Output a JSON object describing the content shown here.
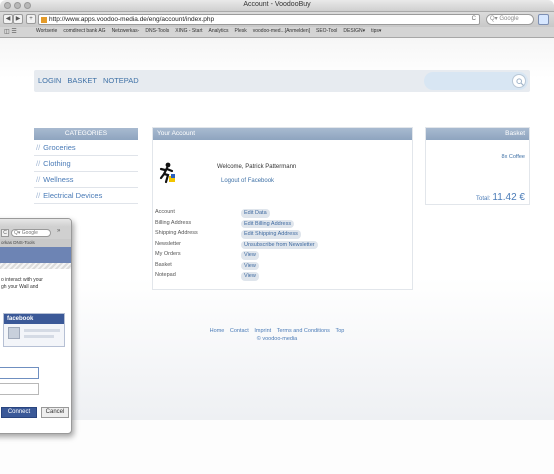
{
  "browser": {
    "window_title": "Account - VoodooBuy",
    "url": "http://www.apps.voodoo-media.de/eng/account/index.php",
    "search_placeholder": "Q▾ Google",
    "bookmarks": [
      "Wortserie",
      "comdirect bank AG",
      "Netzwerkas-",
      "DNS-Tools",
      "XING - Start",
      "Analytics",
      "Plesk",
      "voodoo-med...[Anmelden]",
      "SEO-Tool",
      "DESIGN▾",
      "tips▾"
    ]
  },
  "topnav": {
    "links": [
      "LOGIN",
      "BASKET",
      "NOTEPAD"
    ]
  },
  "categories": {
    "title": "CATEGORIES",
    "items": [
      "Groceries",
      "Clothing",
      "Wellness",
      "Electrical Devices"
    ]
  },
  "account": {
    "title": "Your Account",
    "welcome": "Welcome, Patrick Pattermann",
    "logout": "Logout of Facebook",
    "rows": [
      {
        "label": "Account",
        "button": "Edit Data"
      },
      {
        "label": "Billing Address",
        "button": "Edit Billing Address"
      },
      {
        "label": "Shipping Address",
        "button": "Edit Shipping Address"
      },
      {
        "label": "Newsletter",
        "button": "Unsubscribe from Newsletter"
      },
      {
        "label": "My Orders",
        "button": "View"
      },
      {
        "label": "Basket",
        "button": "View"
      },
      {
        "label": "Notepad",
        "button": "View"
      }
    ]
  },
  "basket": {
    "title": "Basket",
    "item": "8x Coffee",
    "total_label": "Total:",
    "total_value": "11.42 €"
  },
  "footer": {
    "links": [
      "Home",
      "Contact",
      "Imprint",
      "Terms and Conditions",
      "Top"
    ],
    "copyright": "© voodoo-media"
  },
  "popup": {
    "search_placeholder": "Q▾ Google",
    "bookmarks": "orkas   DNS-Tools",
    "text": "o interact with your\ngh your Wall and",
    "facebook_label": "facebook",
    "connect_label": "Connect",
    "cancel_label": "Cancel"
  },
  "colors": {
    "accent": "#4a7bb7",
    "header_bar": "#8ea4bf",
    "facebook_blue": "#3b5998"
  }
}
